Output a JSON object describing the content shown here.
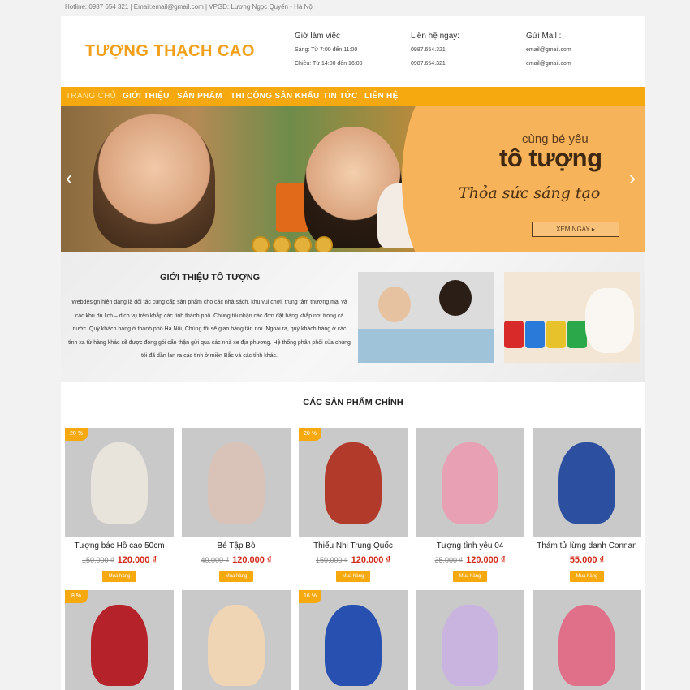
{
  "topbar": {
    "text": "Hotline: 0987 654 321 | Email:email@gmail.com | VPGD: Lương Ngọc Quyến - Hà Nội"
  },
  "header": {
    "logo": "TƯỢNG THẠCH CAO",
    "hours": {
      "title": "Giờ làm việc",
      "morning": "Sáng: Từ 7:00 đến 11:00",
      "afternoon": "Chiều: Từ 14:00 đến 16:00"
    },
    "contact": {
      "title": "Liên hệ ngay:",
      "phone1": "0987.654.321",
      "phone2": "0987.654.321"
    },
    "mail": {
      "title": "Gửi Mail :",
      "email1": "email@gmail.com",
      "email2": "email@gmail.com"
    }
  },
  "nav": {
    "items": [
      {
        "label": "TRANG CHỦ",
        "active": true
      },
      {
        "label": "GIỚI THIỆU"
      },
      {
        "label": "SẢN PHẨM"
      },
      {
        "label": "THI CÔNG SÂN KHẤU"
      },
      {
        "label": "TIN TỨC"
      },
      {
        "label": "LIÊN HỆ"
      }
    ]
  },
  "banner": {
    "line1": "cùng bé yêu",
    "line2": "tô tượng",
    "line3": "Thỏa sức sáng tạo",
    "button": "XEM NGAY ▸",
    "prev": "‹",
    "next": "›"
  },
  "intro": {
    "title": "GIỚI THIỆU TÔ TƯỢNG",
    "body": "Webdesign hiện đang là đối tác cung cấp sản phẩm cho các nhà sách, khu vui chơi, trung tâm thương mại và các khu du lịch – dịch vụ trên khắp các tỉnh thành phố. Chúng tôi nhận các đơn đặt hàng khắp nơi trong cả nước. Quý khách hàng ở thành phố Hà Nội, Chúng tôi sẽ giao hàng tận nơi. Ngoài ra, quý khách hàng ở các tỉnh xa từ hàng khác sẽ được đóng gói cẩn thận gửi qua các nhà xe địa phương. Hệ thống phân phối của chúng tôi đã dần lan ra các tỉnh ở miền Bắc và các tỉnh khác."
  },
  "products": {
    "title": "CÁC SẢN PHẨM CHÍNH",
    "buy_label": "Mua hàng",
    "items": [
      {
        "name": "Tượng bác Hồ cao 50cm",
        "old_price": "150.000 ₫",
        "price": "120.000 ₫",
        "sale": "20 %",
        "color": "#e8e4dc"
      },
      {
        "name": "Bé Tập Bò",
        "old_price": "40.000 ₫",
        "price": "120.000 ₫",
        "sale": "",
        "color": "#d9c3b8"
      },
      {
        "name": "Thiếu Nhi Trung Quốc",
        "old_price": "150.000 ₫",
        "price": "120.000 ₫",
        "sale": "20 %",
        "color": "#b23a2a"
      },
      {
        "name": "Tượng tình yêu 04",
        "old_price": "35.000 ₫",
        "price": "120.000 ₫",
        "sale": "",
        "color": "#e8a0b4"
      },
      {
        "name": "Thám tử lừng danh Connan",
        "old_price": "",
        "price": "55.000 ₫",
        "sale": "",
        "color": "#2c4fa0"
      },
      {
        "sale": "8 %",
        "color": "#b5222a"
      },
      {
        "sale": "",
        "color": "#f0d5b5"
      },
      {
        "sale": "16 %",
        "color": "#2850b0"
      },
      {
        "sale": "",
        "color": "#c9b4e0"
      },
      {
        "sale": "",
        "color": "#e0708a"
      }
    ]
  }
}
